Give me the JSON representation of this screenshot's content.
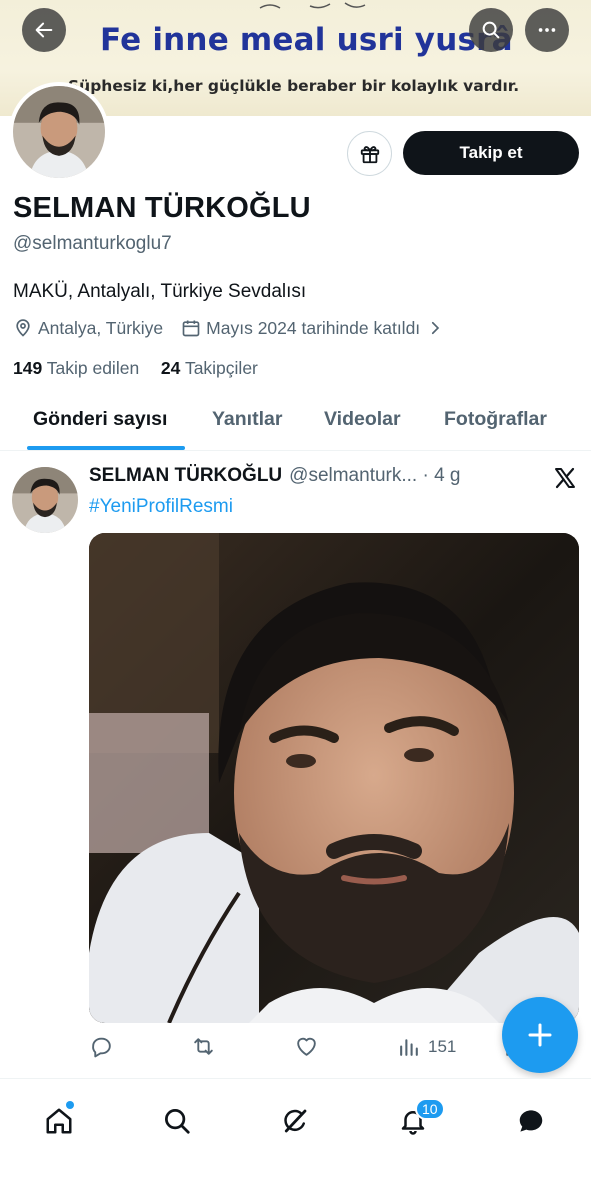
{
  "banner": {
    "title": "Fe inne meal usri yusrâ",
    "subtitle": "Şüphesiz ki,her güçlükle beraber bir kolaylık vardır."
  },
  "top_bar": {
    "back_icon": "arrow-left-icon",
    "search_icon": "search-icon",
    "more_icon": "more-horizontal-icon"
  },
  "profile": {
    "name": "SELMAN TÜRKOĞLU",
    "handle": "@selmanturkoglu7",
    "bio": "MAKÜ, Antalyalı, Türkiye Sevdalısı",
    "location": "Antalya, Türkiye",
    "joined": "Mayıs 2024 tarihinde katıldı",
    "following_count": "149",
    "following_label": "Takip edilen",
    "followers_count": "24",
    "followers_label": "Takipçiler",
    "follow_button": "Takip et"
  },
  "tabs": [
    {
      "label": "Gönderi sayısı",
      "active": true
    },
    {
      "label": "Yanıtlar",
      "active": false
    },
    {
      "label": "Videolar",
      "active": false
    },
    {
      "label": "Fotoğraflar",
      "active": false
    }
  ],
  "post": {
    "author_name": "SELMAN TÜRKOĞLU",
    "author_handle_time": "@selmanturk... · 4 g",
    "hashtag": "#YeniProfilResmi",
    "views": "151"
  },
  "bottom_nav": {
    "notifications_badge": "10"
  },
  "colors": {
    "accent": "#1d9bf0",
    "text_primary": "#0f1419",
    "text_secondary": "#536471",
    "banner_title": "#21349a"
  }
}
